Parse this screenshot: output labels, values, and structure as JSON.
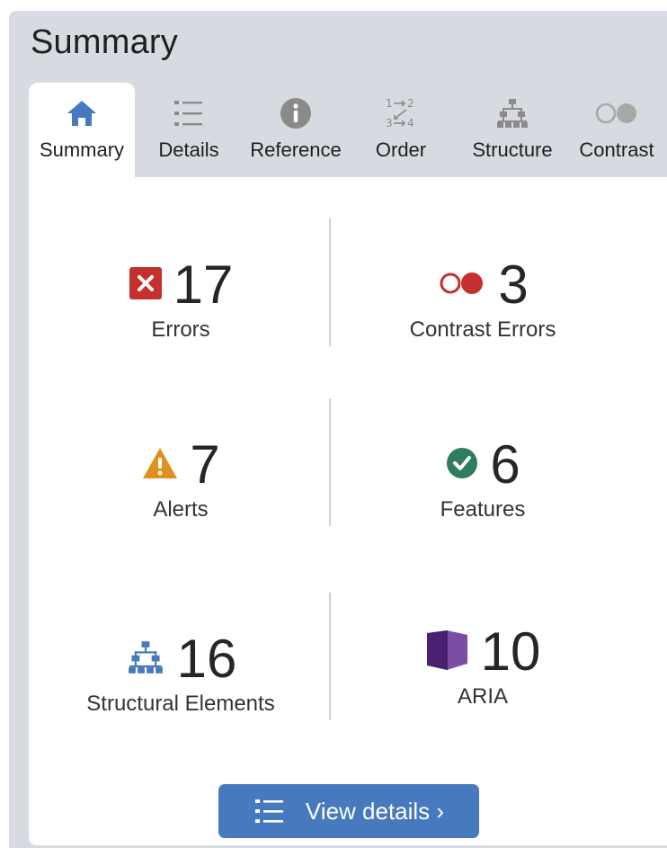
{
  "panel": {
    "title": "Summary"
  },
  "tabs": [
    {
      "label": "Summary",
      "icon": "home-icon",
      "active": true
    },
    {
      "label": "Details",
      "icon": "list-icon",
      "active": false
    },
    {
      "label": "Reference",
      "icon": "info-icon",
      "active": false
    },
    {
      "label": "Order",
      "icon": "order-icon",
      "active": false
    },
    {
      "label": "Structure",
      "icon": "structure-icon",
      "active": false
    },
    {
      "label": "Contrast",
      "icon": "contrast-icon",
      "active": false
    }
  ],
  "stats": {
    "errors": {
      "count": "17",
      "label": "Errors",
      "icon": "error-icon"
    },
    "contrast_errors": {
      "count": "3",
      "label": "Contrast Errors",
      "icon": "contrast-error-icon"
    },
    "alerts": {
      "count": "7",
      "label": "Alerts",
      "icon": "alert-icon"
    },
    "features": {
      "count": "6",
      "label": "Features",
      "icon": "feature-icon"
    },
    "structural": {
      "count": "16",
      "label": "Structural Elements",
      "icon": "structure-icon"
    },
    "aria": {
      "count": "10",
      "label": "ARIA",
      "icon": "aria-icon"
    }
  },
  "view_details": {
    "label": "View details ›",
    "icon": "list-icon"
  },
  "colors": {
    "accent": "#4679bd",
    "error": "#c4302e",
    "alert": "#e0901f",
    "feature": "#2e7d5b",
    "aria": "#5b2d82",
    "tab_icon_muted": "#8a8a8a",
    "panel_bg": "#d7dbe1"
  }
}
